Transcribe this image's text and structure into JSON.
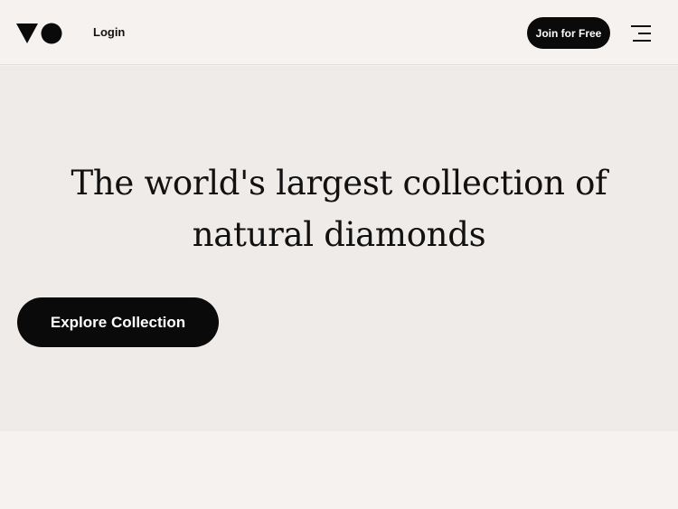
{
  "header": {
    "logo_icon": "triangle-circle-logo",
    "login_label": "Login",
    "join_label": "Join for Free",
    "menu_icon": "hamburger-menu-icon"
  },
  "hero": {
    "title_line1": "The world's largest collection of",
    "title_line2": "natural diamonds",
    "cta_label": "Explore Collection"
  },
  "colors": {
    "page_bg": "#f5f2ef",
    "hero_bg": "#efebe8",
    "button_bg": "#0a0a0a",
    "button_text": "#ffffff"
  }
}
